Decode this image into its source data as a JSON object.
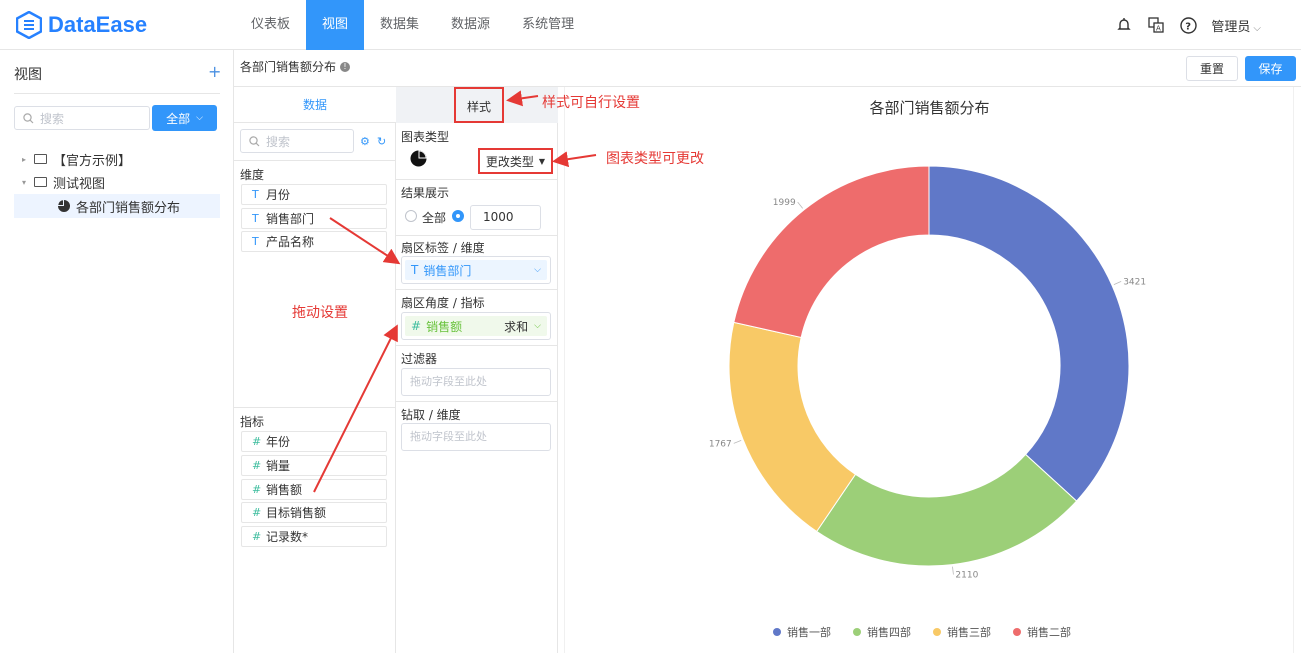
{
  "app": {
    "logo_text": "DataEase"
  },
  "nav": {
    "items": [
      "仪表板",
      "视图",
      "数据集",
      "数据源",
      "系统管理"
    ],
    "active_index": 1
  },
  "topbar": {
    "user": "管理员"
  },
  "left_panel": {
    "title": "视图",
    "search_placeholder": "搜索",
    "filter_button": "全部",
    "tree": [
      {
        "label": "【官方示例】"
      },
      {
        "label": "测试视图"
      },
      {
        "label": "各部门销售额分布"
      }
    ]
  },
  "editor": {
    "breadcrumb": "各部门销售额分布",
    "reset_label": "重置",
    "save_label": "保存",
    "tab_data": "数据",
    "tab_style": "样式",
    "field_search_placeholder": "搜索",
    "dimension_label": "维度",
    "dimensions": [
      "月份",
      "销售部门",
      "产品名称"
    ],
    "measure_label": "指标",
    "measures": [
      "年份",
      "销量",
      "销售额",
      "目标销售额",
      "记录数*"
    ]
  },
  "config": {
    "chart_type_label": "图表类型",
    "change_type_label": "更改类型",
    "result_label": "结果展示",
    "result_all": "全部",
    "result_limit": "1000",
    "sector_label_title": "扇区标签 / 维度",
    "sector_label_field": "销售部门",
    "sector_angle_title": "扇区角度 / 指标",
    "sector_angle_field": "销售额",
    "sector_angle_agg": "求和",
    "filter_title": "过滤器",
    "filter_placeholder": "拖动字段至此处",
    "drill_title": "钻取 / 维度",
    "drill_placeholder": "拖动字段至此处"
  },
  "annotations": {
    "style_note": "样式可自行设置",
    "type_note": "图表类型可更改",
    "drag_note": "拖动设置"
  },
  "chart_data": {
    "type": "pie",
    "title": "各部门销售额分布",
    "categories": [
      "销售一部",
      "销售四部",
      "销售三部",
      "销售二部"
    ],
    "values": [
      3421,
      2110,
      1767,
      1999
    ],
    "colors": [
      "#6078c8",
      "#9ccf78",
      "#f8c966",
      "#ee6c6c"
    ],
    "donut": true,
    "legend_position": "bottom"
  }
}
